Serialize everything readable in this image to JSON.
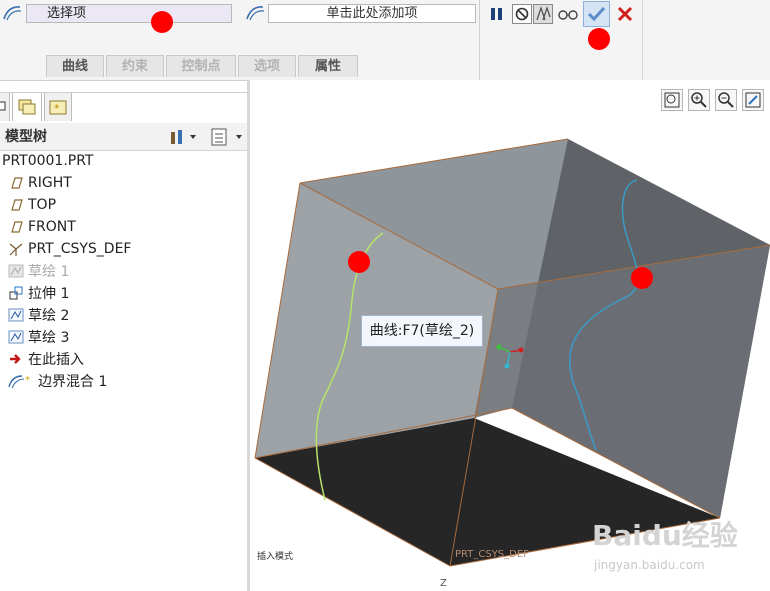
{
  "dashboard": {
    "select_collector": "选择项",
    "add_collector": "单击此处添加项",
    "tabs": [
      {
        "label": "曲线",
        "enabled": true
      },
      {
        "label": "约束",
        "enabled": false
      },
      {
        "label": "控制点",
        "enabled": false
      },
      {
        "label": "选项",
        "enabled": false
      },
      {
        "label": "属性",
        "enabled": true
      }
    ],
    "controls": [
      "pause-icon",
      "no-preview-icon",
      "preview-icon",
      "glasses-icon",
      "check-icon",
      "cancel-icon"
    ]
  },
  "tree": {
    "title": "模型树",
    "items": [
      {
        "label": "PRT0001.PRT",
        "icon": "part-icon",
        "dimmed": false
      },
      {
        "label": "RIGHT",
        "icon": "datum-plane-icon",
        "dimmed": false
      },
      {
        "label": "TOP",
        "icon": "datum-plane-icon",
        "dimmed": false
      },
      {
        "label": "FRONT",
        "icon": "datum-plane-icon",
        "dimmed": false
      },
      {
        "label": "PRT_CSYS_DEF",
        "icon": "csys-icon",
        "dimmed": false
      },
      {
        "label": "草绘 1",
        "icon": "sketch-icon",
        "dimmed": true
      },
      {
        "label": "拉伸 1",
        "icon": "extrude-icon",
        "dimmed": false
      },
      {
        "label": "草绘 2",
        "icon": "sketch-icon",
        "dimmed": false
      },
      {
        "label": "草绘 3",
        "icon": "sketch-icon",
        "dimmed": false
      },
      {
        "label": "在此插入",
        "icon": "insert-arrow-icon",
        "dimmed": false
      },
      {
        "label": "边界混合 1",
        "icon": "boundary-blend-icon",
        "dimmed": false
      }
    ]
  },
  "viewport": {
    "tooltip": "曲线:F7(草绘_2)",
    "mode_text": "插入模式",
    "csys_label": "PRT_CSYS_DEF",
    "axis_label": "Z",
    "view_buttons": [
      "refit-icon",
      "zoom-in-icon",
      "zoom-out-icon",
      "repaint-icon"
    ]
  },
  "watermark": {
    "brand": "Baidu经验",
    "site": "jingyan.baidu.com"
  },
  "colors": {
    "marker": "#ff0000",
    "curve_green": "#b6e36a",
    "curve_blue": "#3a9bc9",
    "edge": "#a86a3c",
    "check_accent": "#2a74c4",
    "cancel_accent": "#d0201c"
  }
}
